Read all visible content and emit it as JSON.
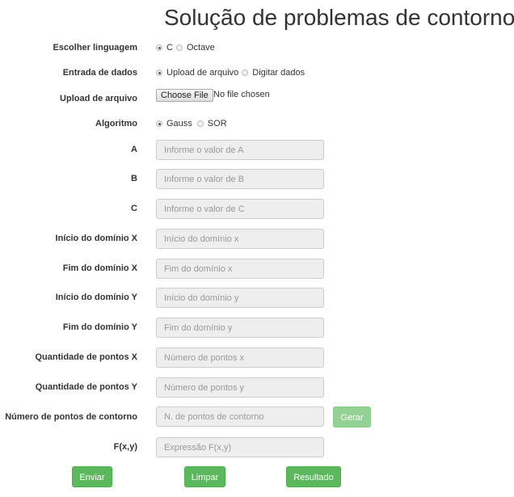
{
  "title": "Solução de problemas de contorno",
  "language": {
    "label": "Escolher linguagem",
    "options": [
      "C",
      "Octave"
    ],
    "selected": "C"
  },
  "input_mode": {
    "label": "Entrada de dados",
    "options": [
      "Upload de arquivo",
      "Digitar dados"
    ],
    "selected": "Upload de arquivo"
  },
  "upload": {
    "label": "Upload de arquivo",
    "button": "Choose File",
    "status": "No file chosen"
  },
  "algorithm": {
    "label": "Algoritmo",
    "options": [
      "Gauss",
      "SOR"
    ],
    "selected": "Gauss"
  },
  "fields": {
    "a": {
      "label": "A",
      "placeholder": "Informe o valor de A"
    },
    "b": {
      "label": "B",
      "placeholder": "Informe o valor de B"
    },
    "c": {
      "label": "C",
      "placeholder": "Informe o valor de C"
    },
    "x_start": {
      "label": "Início do domínio X",
      "placeholder": "Início do domínio x"
    },
    "x_end": {
      "label": "Fim do domínio X",
      "placeholder": "Fim do domínio x"
    },
    "y_start": {
      "label": "Início do domínio Y",
      "placeholder": "Início do domínio y"
    },
    "y_end": {
      "label": "Fim do domínio Y",
      "placeholder": "Fim do domínio y"
    },
    "points_x": {
      "label": "Quantidade de pontos X",
      "placeholder": "Número de pontos x"
    },
    "points_y": {
      "label": "Quantidade de pontos Y",
      "placeholder": "Número de pontos y"
    },
    "boundary_points": {
      "label": "Número de pontos de contorno",
      "placeholder": "N. de pontos de contorno"
    },
    "fxy": {
      "label": "F(x,y)",
      "placeholder": "Expressão F(x,y)"
    }
  },
  "buttons": {
    "gerar": "Gerar",
    "enviar": "Enviar",
    "limpar": "Limpar",
    "resultado": "Resultado"
  },
  "colors": {
    "primary_green": "#5cb85c",
    "disabled_green": "#94d194",
    "input_bg": "#eeeeee"
  }
}
